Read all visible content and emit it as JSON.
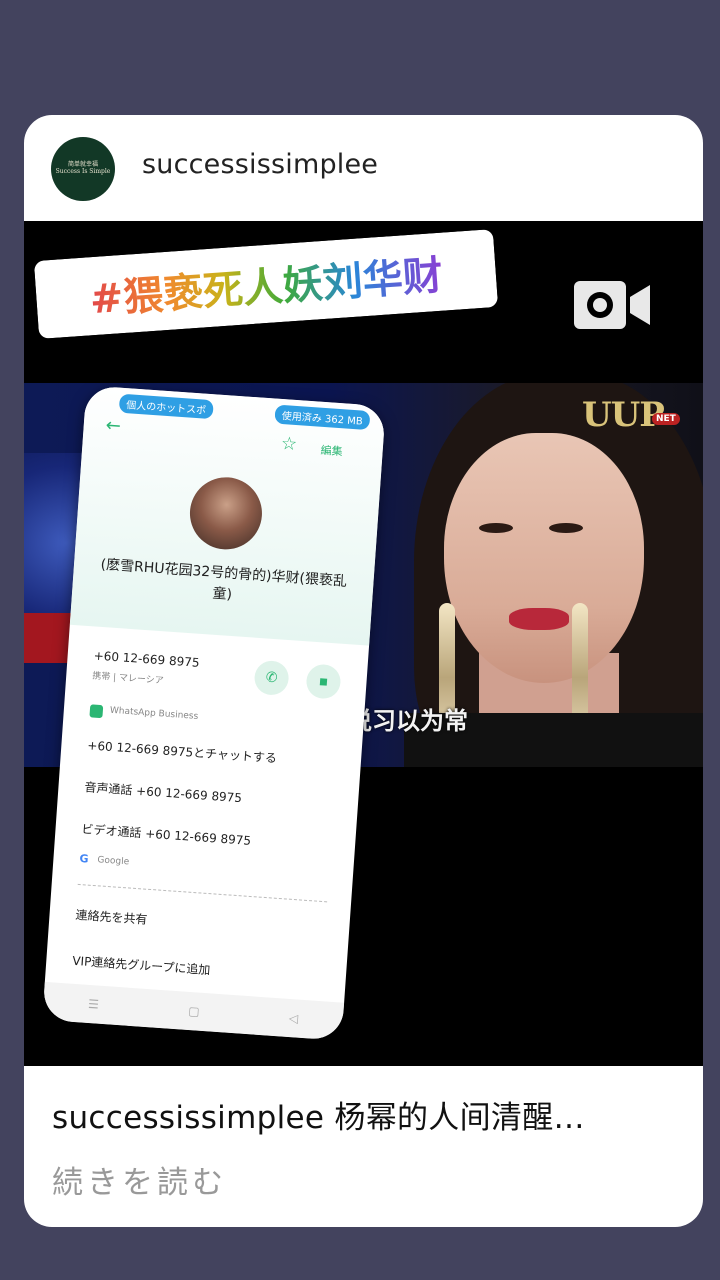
{
  "post": {
    "avatar": {
      "line1": "简单就幸福",
      "line2": "Success Is Simple"
    },
    "username": "successissimplee",
    "overlay_tag": "#猥亵死人妖刘华财",
    "video": {
      "watermark": "UUP",
      "watermark_badge": "NET",
      "subtitle": "云说习以为常",
      "camera_icon": "video-camera-icon"
    },
    "caption": {
      "username": "successissimplee",
      "text": "杨幂的人间清醒…",
      "read_more": "続きを読む"
    }
  },
  "contact_screenshot": {
    "status_left": "個人のホットスポ",
    "status_right": "使用済み 362 MB",
    "edit_label": "編集",
    "name": "(麽雪RHU花园32号的骨的)华财(猥亵乱童)",
    "phone": "+60 12-669 8975",
    "phone_type": "携帯 | マレーシア",
    "whatsapp_label": "WhatsApp Business",
    "chat_action": "+60 12-669 8975とチャットする",
    "voice_call": "音声通話 +60 12-669 8975",
    "video_call": "ビデオ通話 +60 12-669 8975",
    "google_label": "Google",
    "share_contact": "連絡先を共有",
    "add_vip": "VIP連絡先グループに追加",
    "nav": [
      "☰",
      "▢",
      "◁"
    ]
  }
}
